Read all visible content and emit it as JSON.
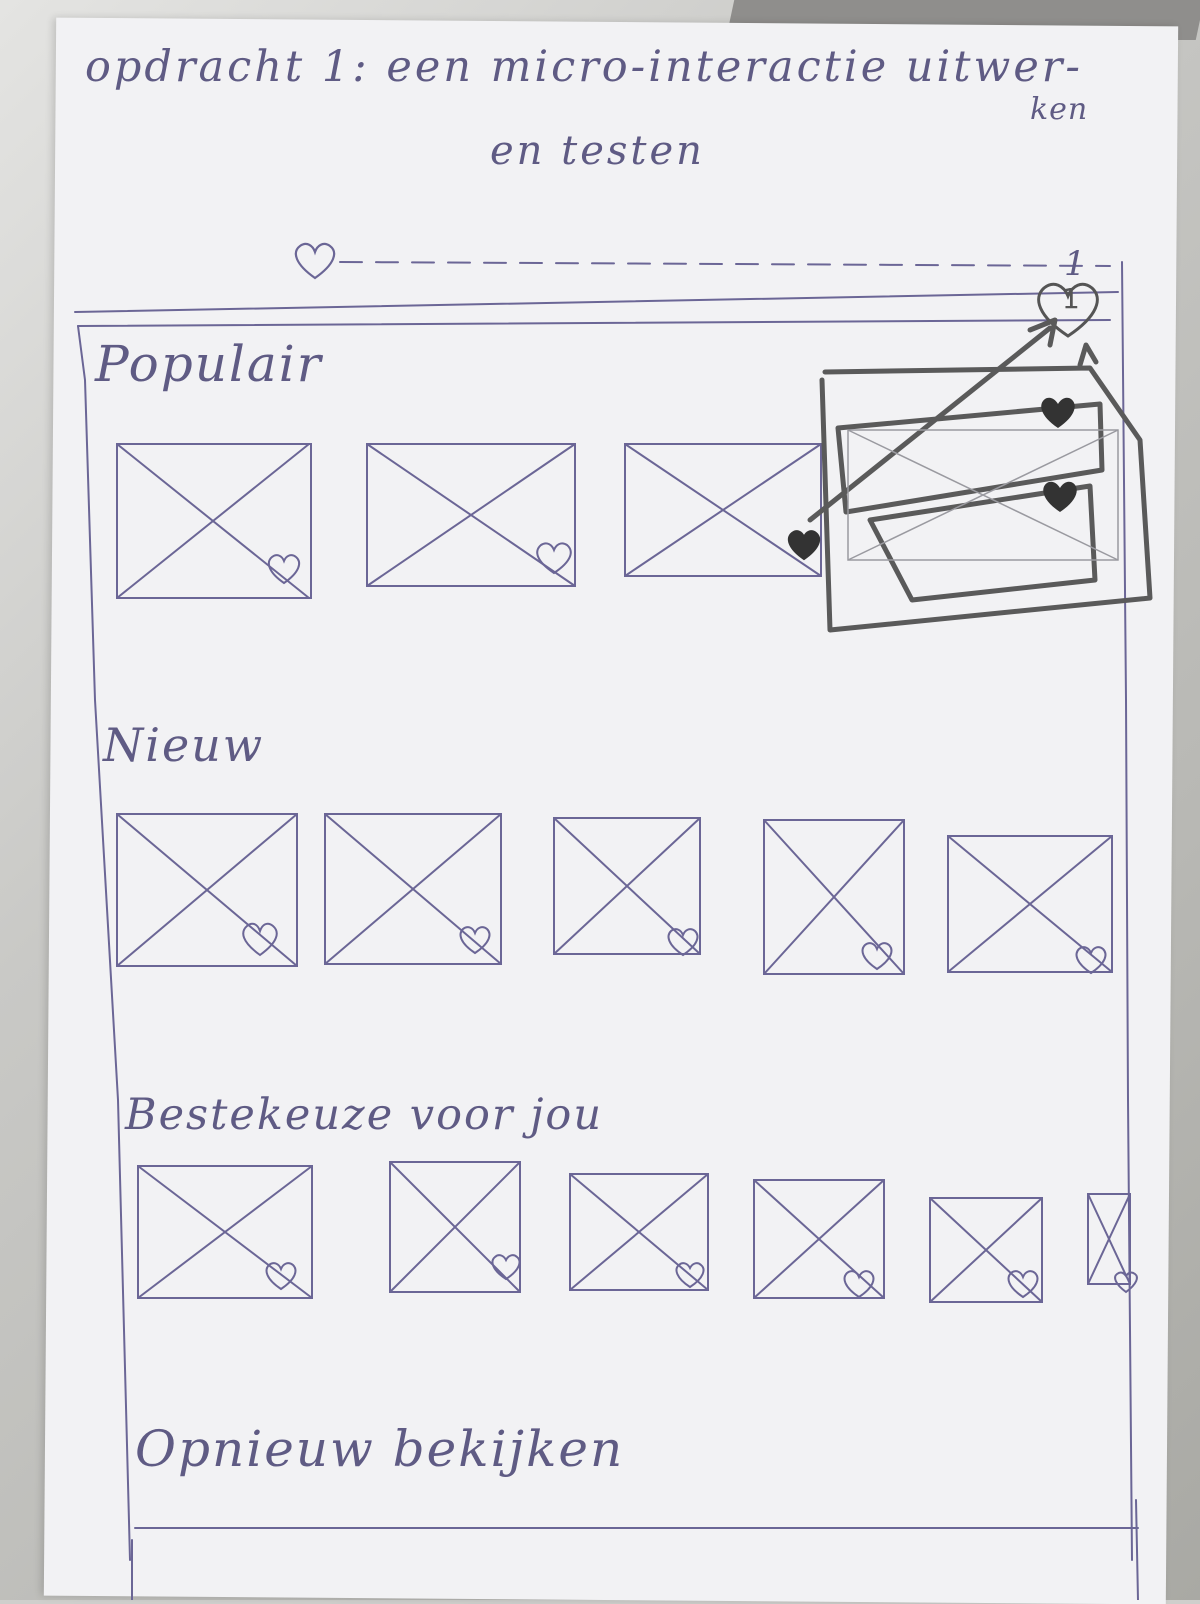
{
  "title": {
    "line1": "opdracht 1: een micro-interactie uitwer-",
    "line1_wrap": "ken",
    "line2": "en testen"
  },
  "topbar": {
    "favorites_counter": "1",
    "badge_count": "1"
  },
  "sections": [
    {
      "label": "Populair",
      "thumb_count": 3
    },
    {
      "label": "Nieuw",
      "thumb_count": 5
    },
    {
      "label": "Bestekeuze voor jou",
      "thumb_count": 6
    },
    {
      "label": "Opnieuw bekijken",
      "thumb_count": 0
    }
  ],
  "colors": {
    "ink": "#5f5b84",
    "pencil": "#5a5a5a",
    "paper": "#f2f2f4"
  }
}
